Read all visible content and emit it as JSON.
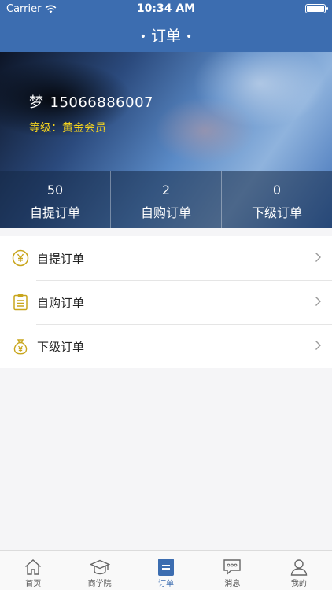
{
  "status": {
    "carrier": "Carrier",
    "time": "10:34 AM"
  },
  "nav": {
    "title": "订单"
  },
  "profile": {
    "name": "梦",
    "phone": "15066886007",
    "level": "等级：黄金会员"
  },
  "stats": [
    {
      "value": "50",
      "label": "自提订单"
    },
    {
      "value": "2",
      "label": "自购订单"
    },
    {
      "value": "0",
      "label": "下级订单"
    }
  ],
  "menu": [
    {
      "label": "自提订单",
      "icon": "yen-circle-icon"
    },
    {
      "label": "自购订单",
      "icon": "clipboard-icon"
    },
    {
      "label": "下级订单",
      "icon": "money-bag-icon"
    }
  ],
  "tabs": [
    {
      "label": "首页",
      "icon": "home-icon"
    },
    {
      "label": "商学院",
      "icon": "graduation-cap-icon"
    },
    {
      "label": "订单",
      "icon": "order-icon",
      "active": true
    },
    {
      "label": "消息",
      "icon": "chat-icon"
    },
    {
      "label": "我的",
      "icon": "person-icon"
    }
  ],
  "colors": {
    "brand": "#3c6db0",
    "gold": "#f3d21f",
    "icon_gold": "#c8a51b"
  }
}
